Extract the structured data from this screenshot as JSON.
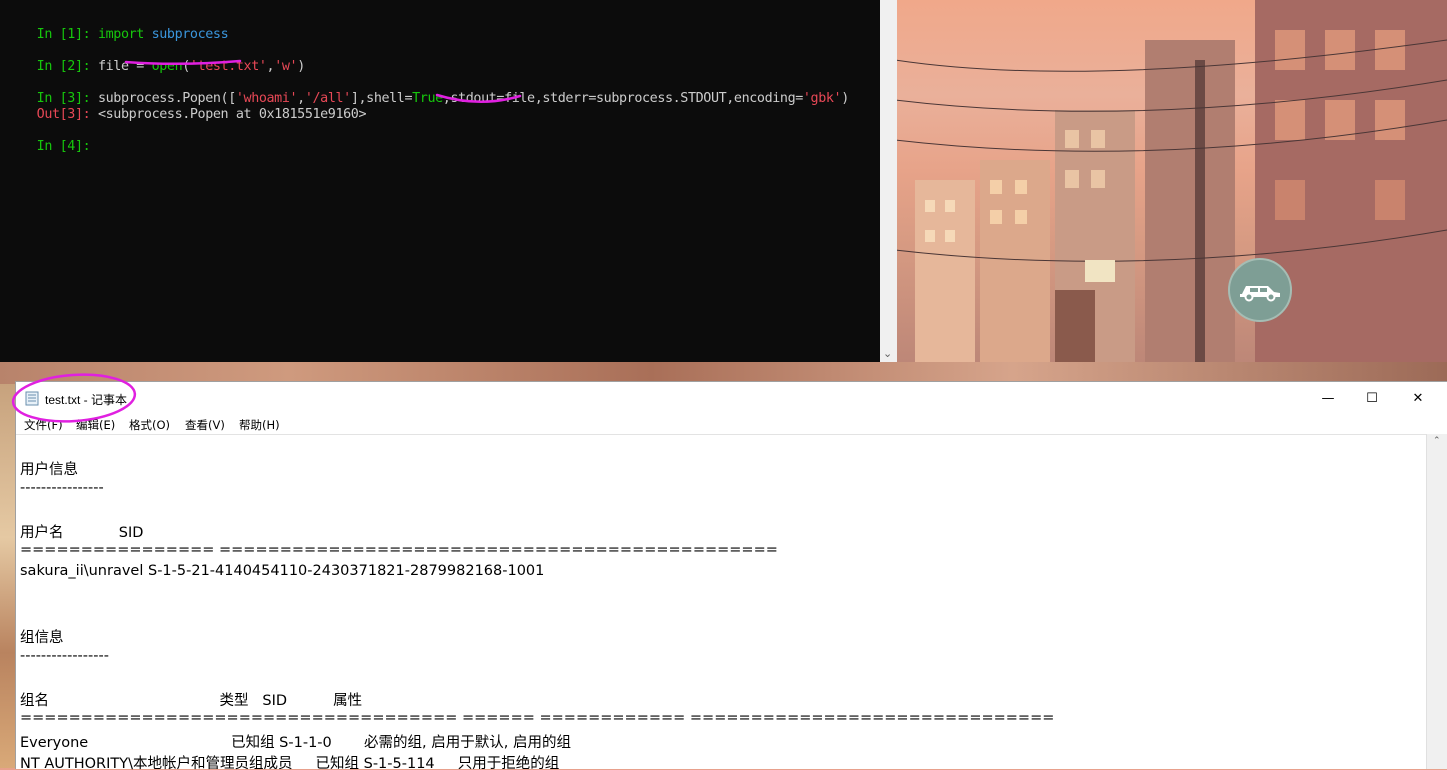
{
  "terminal": {
    "lines": [
      {
        "prompt": "In [1]: ",
        "code": "import subprocess"
      },
      {
        "prompt": "In [2]: ",
        "code_a": "file = ",
        "code_b": "open",
        "code_c": "(",
        "code_d": "'test.txt'",
        "code_e": ",",
        "code_f": "'w'",
        "code_g": ")"
      },
      {
        "prompt": "In [3]: ",
        "code_a": "subprocess.Popen([",
        "code_b": "'whoami'",
        "code_c": ",",
        "code_d": "'/all'",
        "code_e": "],shell=",
        "code_f": "True",
        "code_g": ",stdout=file,stderr=subprocess.STDOUT,encoding=",
        "code_h": "'gbk'",
        "code_i": ")"
      },
      {
        "prompt": "Out[3]: ",
        "code": "<subprocess.Popen at 0x181551e9160>"
      },
      {
        "prompt": "In [4]: ",
        "code": ""
      }
    ],
    "scroll_chevron": "⌄"
  },
  "notepad": {
    "title": "test.txt - 记事本",
    "window_buttons": {
      "minimize": "—",
      "maximize": "☐",
      "close": "✕"
    },
    "menu": [
      "文件(F)",
      "编辑(E)",
      "格式(O)",
      "查看(V)",
      "帮助(H)"
    ],
    "content_lines": [
      "用户信息",
      "----------------",
      "用户名            SID",
      "================ ==============================================",
      "sakura_ii\\unravel S-1-5-21-4140454110-2430371821-2879982168-1001",
      "组信息",
      "-----------------",
      "组名                                     类型   SID          属性",
      "==================================== ====== ============ ==============================",
      "Everyone                               已知组 S-1-1-0       必需的组, 启用于默认, 启用的组",
      "NT AUTHORITY\\本地帐户和管理员组成员     已知组 S-1-5-114     只用于拒绝的组"
    ],
    "scroll_chevron": "⌃"
  },
  "colors": {
    "terminal_bg": "#0c0c0c",
    "prompt_in": "#16c60c",
    "prompt_out": "#e74856",
    "annotation": "#e020e0"
  }
}
